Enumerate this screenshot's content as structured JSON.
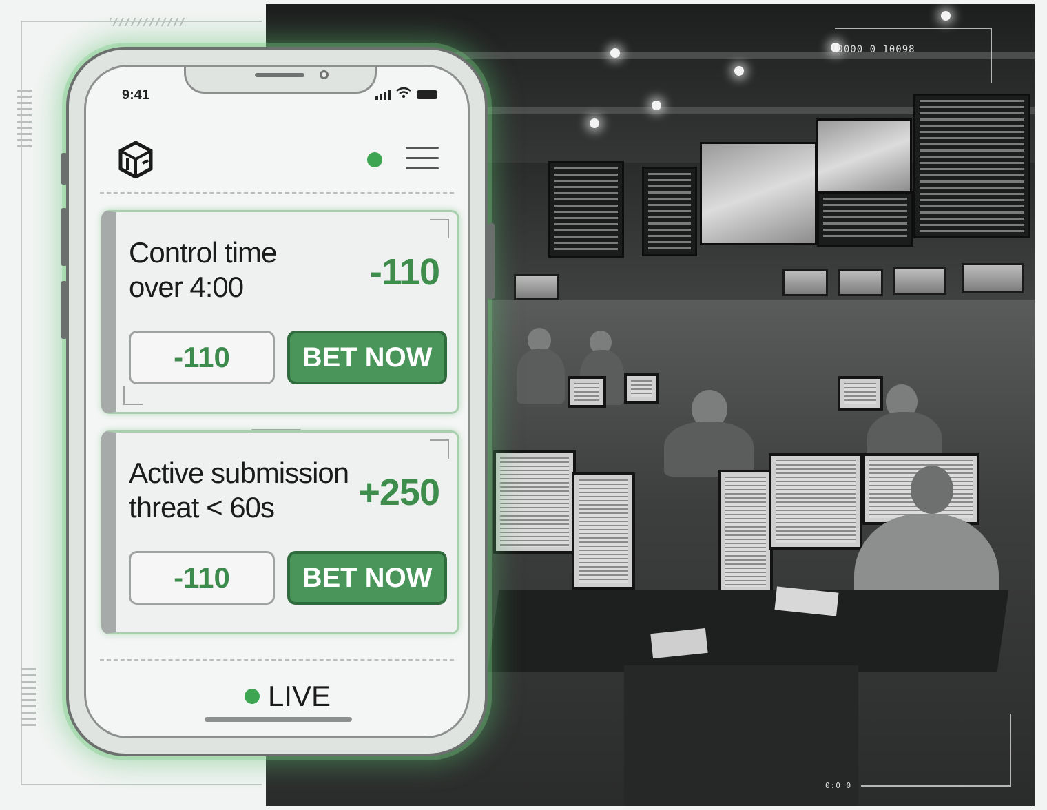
{
  "status_bar": {
    "time": "9:41"
  },
  "header": {
    "logo_icon": "cube-logo-icon",
    "live_indicator_color": "#3ea653",
    "menu_icon": "hamburger-menu-icon"
  },
  "markets": [
    {
      "title_line1": "Control time",
      "title_line2": "over 4:00",
      "odds": "-110",
      "odds_button": "-110",
      "bet_button": "BET NOW"
    },
    {
      "title_line1": "Active submission",
      "title_line2": "threat < 60s",
      "odds": "+250",
      "odds_button": "-110",
      "bet_button": "BET NOW"
    }
  ],
  "footer": {
    "live_label": "LIVE"
  },
  "photo": {
    "hud_top": "!0000 0 10098",
    "hud_bottom": "0:0 0"
  },
  "colors": {
    "accent_green": "#49955a",
    "odds_green": "#3e8d4d",
    "glow": "#5abe6e"
  }
}
